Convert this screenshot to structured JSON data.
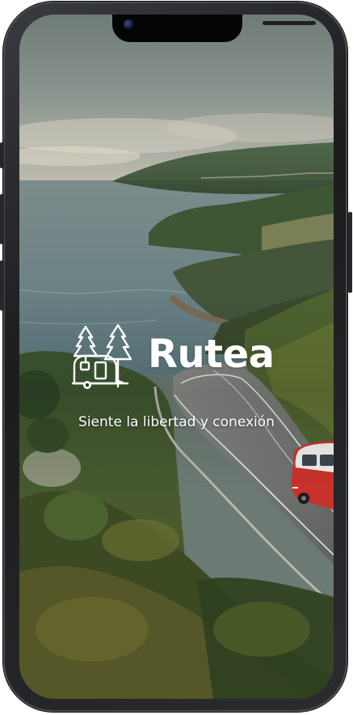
{
  "app": {
    "name": "Rutea",
    "tagline": "Siente la libertad y conexión"
  },
  "icons": {
    "logo": "camper-trailer-pine-trees-icon",
    "camera": "front-camera-icon"
  },
  "colors": {
    "text": "#ffffff",
    "van_red": "#c8322a",
    "frame": "#1c1c1f"
  }
}
